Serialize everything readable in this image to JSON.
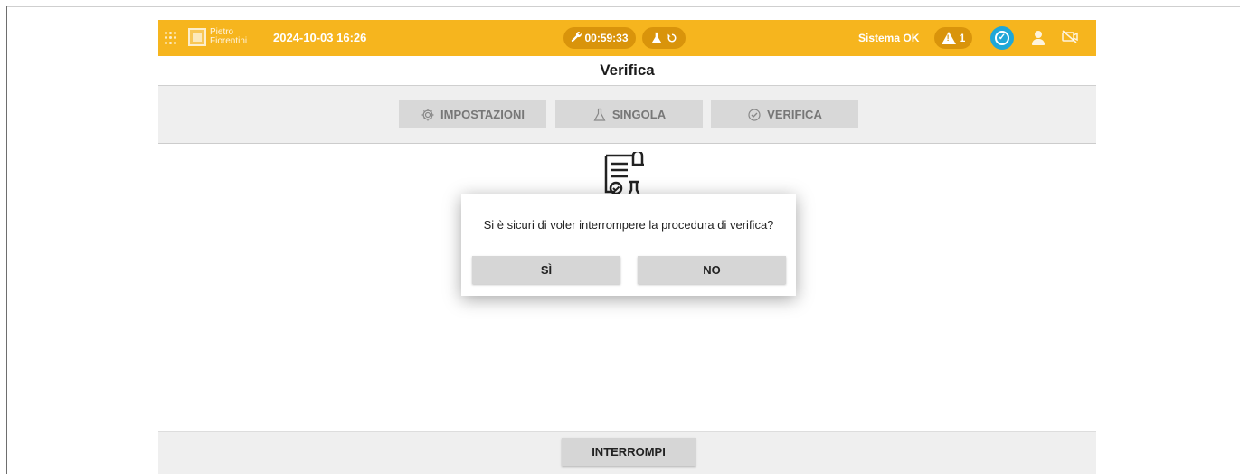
{
  "topbar": {
    "menu_icon": "grid-menu-icon",
    "logo_text_line1": "Pietro",
    "logo_text_line2": "Fiorentini",
    "datetime": "2024-10-03 16:26",
    "timer": "00:59:33",
    "status_text": "Sistema OK",
    "warning_count": "1",
    "accent_color": "#f6b51e",
    "pill_color": "#d9940b",
    "check_color": "#1ea7d8"
  },
  "page": {
    "title": "Verifica"
  },
  "tabs": [
    {
      "label": "IMPOSTAZIONI",
      "icon": "gear-icon"
    },
    {
      "label": "SINGOLA",
      "icon": "flask-icon"
    },
    {
      "label": "VERIFICA",
      "icon": "check-circle-icon"
    }
  ],
  "dialog": {
    "message": "Si è sicuri di voler interrompere la procedura di verifica?",
    "yes_label": "SÌ",
    "no_label": "NO"
  },
  "footer": {
    "stop_label": "INTERROMPI"
  }
}
